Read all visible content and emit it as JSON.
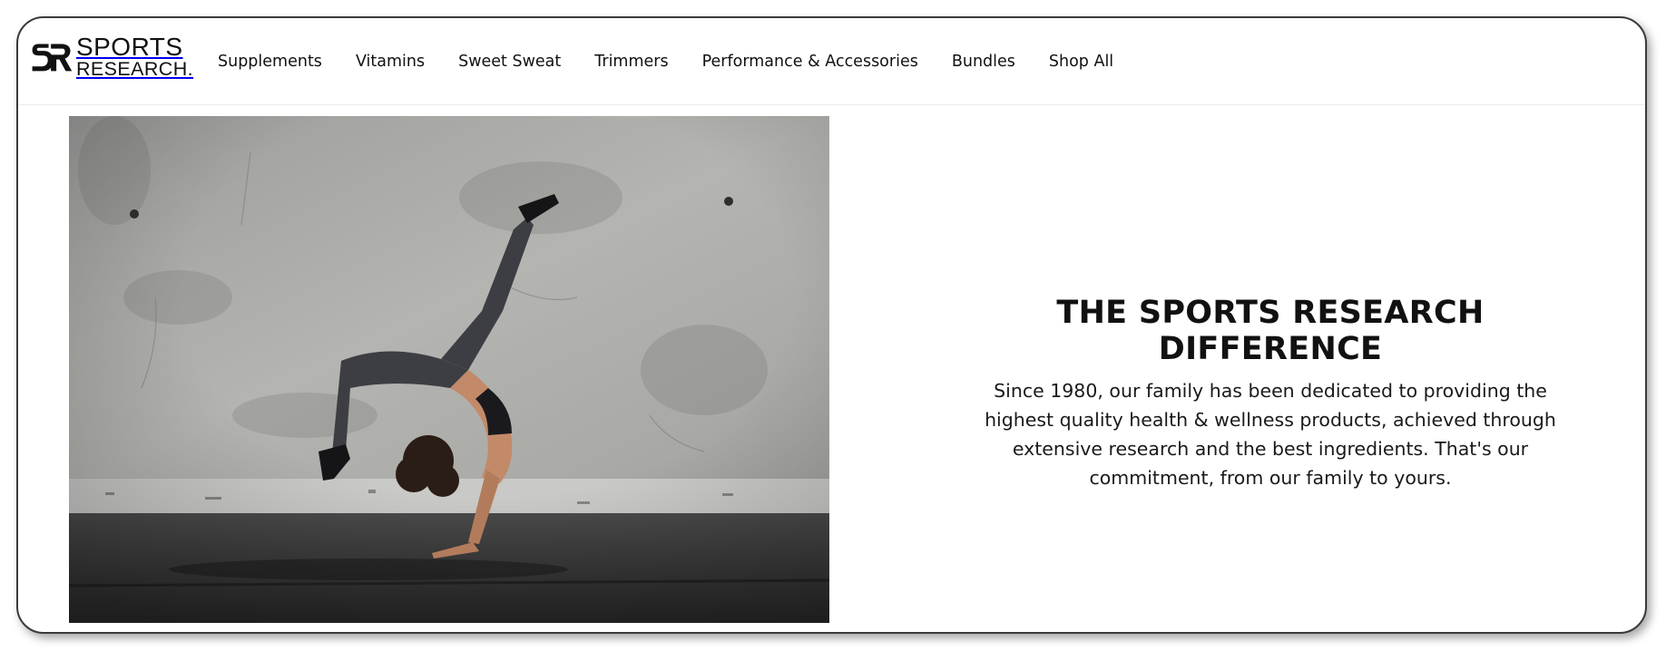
{
  "brand": {
    "logo_line1": "SPORTS",
    "logo_line2": "RESEARCH.",
    "logo_icon": "sr-monogram"
  },
  "nav": {
    "items": [
      {
        "label": "Supplements"
      },
      {
        "label": "Vitamins"
      },
      {
        "label": "Sweet Sweat"
      },
      {
        "label": "Trimmers"
      },
      {
        "label": "Performance & Accessories"
      },
      {
        "label": "Bundles"
      },
      {
        "label": "Shop All"
      }
    ]
  },
  "hero": {
    "image": "athlete-backbend-kick-photo"
  },
  "section": {
    "heading": "THE SPORTS RESEARCH DIFFERENCE",
    "body": "Since 1980, our family has been dedicated to providing the highest quality health & wellness products, achieved through extensive research and the best ingredients. That's our commitment, from our family to yours."
  },
  "colors": {
    "text": "#111111",
    "frame": "#3a3a3a",
    "background": "#ffffff"
  }
}
